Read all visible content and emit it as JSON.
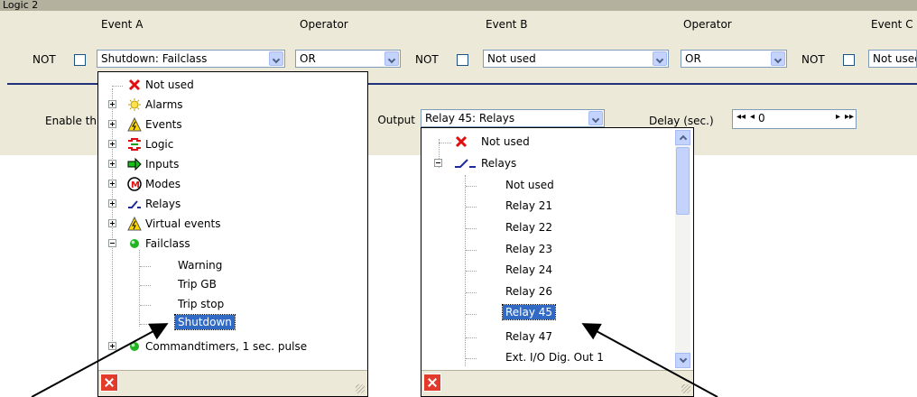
{
  "window": {
    "title": "Logic 2"
  },
  "header": {
    "not_label": "NOT",
    "event_a_label": "Event A",
    "operator_label": "Operator",
    "event_b_label": "Event B",
    "event_c_label": "Event C",
    "event_a_value": "Shutdown: Failclass",
    "operator_1_value": "OR",
    "event_b_value": "Not used",
    "operator_2_value": "OR",
    "event_c_value": "Not used"
  },
  "second_row": {
    "enable_label": "Enable th",
    "output_label": "Output",
    "output_value": "Relay 45: Relays",
    "delay_label": "Delay (sec.)",
    "delay_value": "0",
    "spin_first": "◂◂",
    "spin_prev": "◂",
    "spin_next": "▸",
    "spin_last": "▸▸"
  },
  "event_tree": {
    "items": [
      {
        "label": "Not used",
        "icon": "red-x-icon"
      },
      {
        "label": "Alarms",
        "icon": "alarm-bulb-icon"
      },
      {
        "label": "Events",
        "icon": "warning-triangle-icon"
      },
      {
        "label": "Logic",
        "icon": "logic-icon"
      },
      {
        "label": "Inputs",
        "icon": "input-arrow-icon"
      },
      {
        "label": "Modes",
        "icon": "modes-m-icon"
      },
      {
        "label": "Relays",
        "icon": "relay-switch-icon"
      },
      {
        "label": "Virtual events",
        "icon": "warning-triangle-icon"
      },
      {
        "label": "Failclass",
        "icon": "green-dot-icon"
      },
      {
        "label": "Commandtimers, 1 sec. pulse",
        "icon": "green-dot-icon"
      }
    ],
    "failclass_children": [
      "Warning",
      "Trip GB",
      "Trip stop",
      "Shutdown"
    ],
    "selected": "Shutdown"
  },
  "output_tree": {
    "items": [
      {
        "label": "Not used",
        "icon": "red-x-icon"
      },
      {
        "label": "Relays",
        "icon": "relay-switch-icon"
      }
    ],
    "relay_children": [
      "Not used",
      "Relay 21",
      "Relay 22",
      "Relay 23",
      "Relay 24",
      "Relay 26",
      "Relay 45",
      "Relay 47",
      "Ext. I/O Dig. Out 1"
    ],
    "selected": "Relay 45"
  },
  "colors": {
    "selection": "#316ac5",
    "separator": "#20307a",
    "panel": "#ece9d8",
    "cancel": "#e23a2b"
  }
}
